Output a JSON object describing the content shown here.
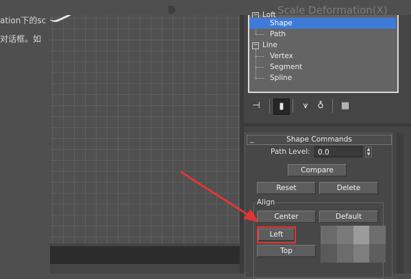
{
  "background": {
    "text_line_1": "ation下的sc",
    "text_line_2": "对话框。如",
    "heading": "Scale Deformation(X)"
  },
  "tree": {
    "items": [
      {
        "label": "Loft",
        "level": 0,
        "expanded": true
      },
      {
        "label": "Shape",
        "level": 1,
        "selected": true
      },
      {
        "label": "Path",
        "level": 1
      },
      {
        "label": "Line",
        "level": 0,
        "expanded": true
      },
      {
        "label": "Vertex",
        "level": 1
      },
      {
        "label": "Segment",
        "level": 1
      },
      {
        "label": "Spline",
        "level": 1
      }
    ],
    "expanded_glyph": "−"
  },
  "toolbar": {
    "icons": [
      "pin-stack-icon",
      "modifier-active-icon",
      "show-end-result-icon",
      "make-unique-icon",
      "configure-modifier-sets-icon"
    ],
    "glyphs": {
      "pin": "⊣",
      "active": "▮",
      "result": "⩛",
      "unique": "♁",
      "configure": "▦"
    }
  },
  "rollout": {
    "title": "Shape Commands",
    "collapse_glyph": "_",
    "path_level_label": "Path Level:",
    "path_level_value": "0.0",
    "spinner_up": "▲",
    "spinner_down": "▼",
    "compare_label": "Compare",
    "reset_label": "Reset",
    "delete_label": "Delete",
    "align_group_label": "Align",
    "center_label": "Center",
    "default_label": "Default",
    "left_label": "Left",
    "top_label": "Top"
  },
  "colors": {
    "selection": "#3f7ad7",
    "highlight": "#e53434"
  }
}
